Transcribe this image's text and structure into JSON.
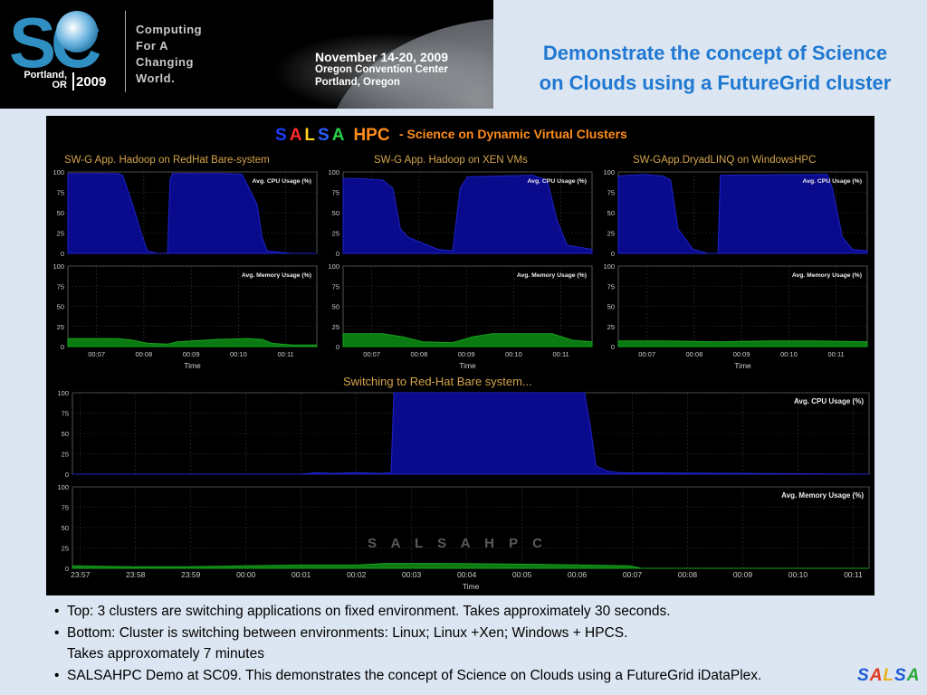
{
  "banner": {
    "logo_text": "SC",
    "logo_city": "Portland, OR",
    "logo_year": "2009",
    "tagline": [
      "Computing",
      "For A",
      "Changing",
      "World."
    ],
    "event_dates": "November 14-20, 2009",
    "event_venue": "Oregon Convention Center",
    "event_city": "Portland, Oregon"
  },
  "slide_title": [
    "Demonstrate the concept of Science",
    "on Clouds using a FutureGrid cluster"
  ],
  "dashboard": {
    "header_letters": [
      {
        "ch": "S",
        "color": "#1a3cff"
      },
      {
        "ch": "A",
        "color": "#ff2a2a"
      },
      {
        "ch": "L",
        "color": "#ffd21a"
      },
      {
        "ch": "S",
        "color": "#2a5cff"
      },
      {
        "ch": "A",
        "color": "#2ad14a"
      }
    ],
    "header_hpc": "HPC",
    "header_subtitle": "- Science on Dynamic Virtual Clusters",
    "switching_text": "Switching to Red-Hat Bare system...",
    "watermark": "S A L S A    H P C",
    "time_label": "Time",
    "cpu_label": "Avg. CPU Usage (%)",
    "mem_label": "Avg. Memory Usage (%)",
    "colors": {
      "cpu": "#0a0a8c",
      "cpu_edge": "#1e24c8",
      "mem": "#0c7a12",
      "title": "#d4a44a",
      "subtitle": "#ff8c1a"
    }
  },
  "chart_data": [
    {
      "type": "area",
      "title": "SW-G App. Hadoop on RedHat Bare-system",
      "panels": [
        {
          "ylabel": "Avg. CPU Usage (%)",
          "ylim": [
            0,
            100
          ],
          "yticks": [
            0,
            25,
            50,
            75,
            100
          ],
          "x_ticks": [
            "00:07",
            "00:08",
            "00:09",
            "00:10",
            "00:11"
          ],
          "x": [
            0,
            0.5,
            1,
            1.1,
            1.3,
            1.5,
            1.6,
            1.8,
            1.9,
            2.0,
            2.05,
            2.1,
            2.2,
            3.2,
            3.5,
            3.8,
            3.9,
            4.0,
            4.5,
            5
          ],
          "values": [
            98,
            98,
            98,
            96,
            60,
            20,
            3,
            0,
            0,
            0,
            90,
            98,
            98,
            98,
            97,
            60,
            20,
            3,
            0,
            0
          ]
        },
        {
          "ylabel": "Avg. Memory Usage (%)",
          "ylim": [
            0,
            100
          ],
          "yticks": [
            0,
            25,
            50,
            75,
            100
          ],
          "xlabel": "Time",
          "x_ticks": [
            "00:07",
            "00:08",
            "00:09",
            "00:10",
            "00:11"
          ],
          "x": [
            0,
            0.5,
            1,
            1.3,
            1.6,
            2.0,
            2.2,
            3.0,
            3.6,
            3.9,
            4.1,
            4.5,
            5
          ],
          "values": [
            10,
            10,
            10,
            8,
            4,
            3,
            6,
            9,
            10,
            9,
            4,
            2,
            2
          ]
        }
      ]
    },
    {
      "type": "area",
      "title": "SW-G App. Hadoop on XEN VMs",
      "panels": [
        {
          "ylabel": "Avg. CPU Usage (%)",
          "ylim": [
            0,
            100
          ],
          "yticks": [
            0,
            25,
            50,
            75,
            100
          ],
          "x_ticks": [
            "00:07",
            "00:08",
            "00:09",
            "00:10",
            "00:11"
          ],
          "x": [
            0,
            0.3,
            0.8,
            1.0,
            1.15,
            1.3,
            1.5,
            1.9,
            2.2,
            2.35,
            2.5,
            3.8,
            4.1,
            4.3,
            4.5,
            5
          ],
          "values": [
            92,
            92,
            90,
            80,
            30,
            20,
            15,
            5,
            3,
            80,
            94,
            96,
            90,
            40,
            10,
            5
          ]
        },
        {
          "ylabel": "Avg. Memory Usage (%)",
          "ylim": [
            0,
            100
          ],
          "yticks": [
            0,
            25,
            50,
            75,
            100
          ],
          "xlabel": "Time",
          "x_ticks": [
            "00:07",
            "00:08",
            "00:09",
            "00:10",
            "00:11"
          ],
          "x": [
            0,
            0.8,
            1.2,
            1.6,
            2.2,
            2.6,
            3.0,
            4.2,
            4.6,
            5
          ],
          "values": [
            16,
            16,
            12,
            6,
            5,
            12,
            16,
            16,
            8,
            6
          ]
        }
      ]
    },
    {
      "type": "area",
      "title": "SW-GApp.DryadLINQ on WindowsHPC",
      "panels": [
        {
          "ylabel": "Avg. CPU Usage (%)",
          "ylim": [
            0,
            100
          ],
          "yticks": [
            0,
            25,
            50,
            75,
            100
          ],
          "x_ticks": [
            "00:07",
            "00:08",
            "00:09",
            "00:10",
            "00:11"
          ],
          "x": [
            0,
            0.5,
            0.9,
            1.05,
            1.2,
            1.5,
            1.8,
            2.0,
            2.05,
            4.2,
            4.3,
            4.5,
            4.7,
            5
          ],
          "values": [
            95,
            97,
            95,
            90,
            30,
            5,
            0,
            0,
            96,
            97,
            80,
            20,
            5,
            3
          ]
        },
        {
          "ylabel": "Avg. Memory Usage (%)",
          "ylim": [
            0,
            100
          ],
          "yticks": [
            0,
            25,
            50,
            75,
            100
          ],
          "xlabel": "Time",
          "x_ticks": [
            "00:07",
            "00:08",
            "00:09",
            "00:10",
            "00:11"
          ],
          "x": [
            0,
            1.0,
            2.0,
            3.0,
            4.0,
            5
          ],
          "values": [
            7,
            7,
            6,
            7,
            7,
            6
          ]
        }
      ]
    },
    {
      "type": "area",
      "title": "Switching to Red-Hat Bare system...",
      "panels": [
        {
          "ylabel": "Avg. CPU Usage (%)",
          "ylim": [
            0,
            100
          ],
          "yticks": [
            0,
            25,
            50,
            75,
            100
          ],
          "x_ticks": [
            "23:57",
            "23:58",
            "23:59",
            "00:00",
            "00:01",
            "00:02",
            "00:03",
            "00:04",
            "00:05",
            "00:06",
            "00:07",
            "00:08",
            "00:09",
            "00:10",
            "00:11"
          ],
          "x": [
            0,
            4.0,
            4.3,
            4.6,
            5.0,
            5.4,
            5.6,
            5.65,
            9.0,
            9.1,
            9.2,
            9.4,
            9.6,
            14
          ],
          "values": [
            0,
            0,
            2,
            1,
            2,
            1,
            2,
            100,
            100,
            60,
            10,
            4,
            2,
            0
          ]
        },
        {
          "ylabel": "Avg. Memory Usage (%)",
          "ylim": [
            0,
            100
          ],
          "yticks": [
            0,
            25,
            50,
            75,
            100
          ],
          "xlabel": "Time",
          "x_ticks": [
            "23:57",
            "23:58",
            "23:59",
            "00:00",
            "00:01",
            "00:02",
            "00:03",
            "00:04",
            "00:05",
            "00:06",
            "00:07",
            "00:08",
            "00:09",
            "00:10",
            "00:11"
          ],
          "x": [
            0,
            1.0,
            2.0,
            3.0,
            4.0,
            5.0,
            5.5,
            6.5,
            8.0,
            9.0,
            9.8,
            10.0,
            14
          ],
          "values": [
            3,
            2,
            2,
            3,
            4,
            4,
            6,
            6,
            5,
            4,
            3,
            0,
            0
          ]
        }
      ]
    }
  ],
  "bullets": [
    {
      "text": "Top: 3 clusters are switching applications on fixed environment. Takes approximately 30 seconds."
    },
    {
      "text": "Bottom: Cluster is switching between environments: Linux; Linux +Xen; Windows + HPCS.",
      "cont": "Takes approxomately 7 minutes"
    },
    {
      "text": "SALSAHPC Demo at SC09. This demonstrates the concept of Science on Clouds using a FutureGrid iDataPlex."
    }
  ],
  "footer_logo": [
    {
      "ch": "S",
      "color": "#1f5bd6"
    },
    {
      "ch": "A",
      "color": "#e03a1e"
    },
    {
      "ch": "L",
      "color": "#e8b21a"
    },
    {
      "ch": "S",
      "color": "#1f5bd6"
    },
    {
      "ch": "A",
      "color": "#2ea83a"
    }
  ]
}
